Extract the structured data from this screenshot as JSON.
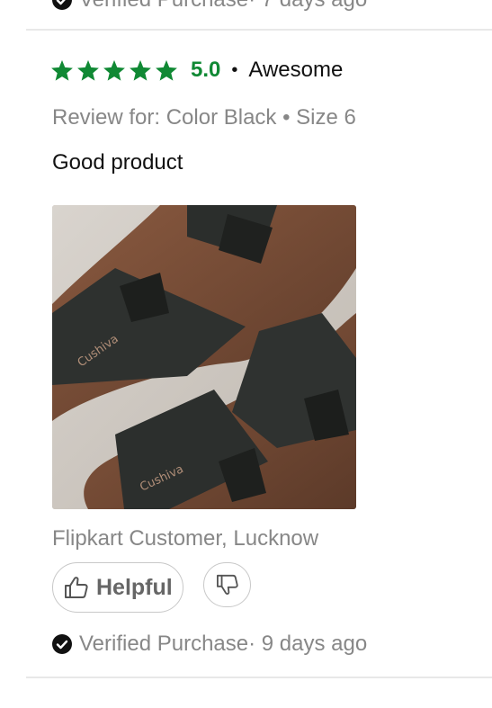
{
  "previous_review": {
    "verified_text": "Verified Purchase",
    "time_text": "· 7 days ago"
  },
  "review": {
    "stars": 5,
    "rating": "5.0",
    "separator": "•",
    "title": "Awesome",
    "variant": "Review for: Color Black • Size 6",
    "text": "Good product",
    "photo_icon": "sandal-photo",
    "author": "Flipkart Customer, Lucknow",
    "helpful_label": "Helpful",
    "verified_text": "Verified Purchase",
    "time_text": "· 9 days ago"
  },
  "icons": {
    "star": "star-icon",
    "thumbs_up": "thumbs-up-icon",
    "thumbs_down": "thumbs-down-icon",
    "check": "check-circle-icon"
  },
  "colors": {
    "star_green": "#108934",
    "muted_text": "#878787",
    "button_border": "#c8c8c8",
    "divider": "#e8e8e8"
  }
}
